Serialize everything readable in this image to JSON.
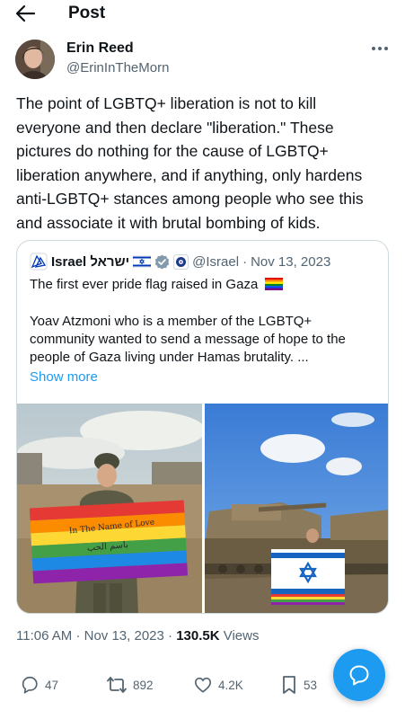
{
  "header": {
    "title": "Post"
  },
  "author": {
    "name": "Erin Reed",
    "handle": "@ErinInTheMorn"
  },
  "tweet": {
    "lines": [
      "The point of LGBTQ+ liberation is not to kill",
      "everyone and then declare \"liberation.\" These",
      "pictures do nothing for the cause of LGBTQ+",
      "liberation anywhere, and if anything, only hardens",
      "anti-LGBTQ+ stances among people who see this",
      "and associate it with brutal bombing of kids."
    ]
  },
  "quote": {
    "name": "Israel ישראל",
    "handle": "@Israel",
    "separator": "·",
    "date": "Nov 13, 2023",
    "line1": "The first ever pride flag raised in Gaza",
    "body_lines": [
      "Yoav Atzmoni who is a member of the LGBTQ+",
      "community wanted to send a message of hope to the",
      "people of Gaza living under Hamas brutality. ..."
    ],
    "show_more": "Show more",
    "photo1_flag_text": "In The Name of Love",
    "photo1_flag_text2": "باسم الحب"
  },
  "meta": {
    "time": "11:06 AM",
    "sep": "·",
    "date": "Nov 13, 2023",
    "views_count": "130.5K",
    "views_label": "Views"
  },
  "actions": {
    "replies": "47",
    "reposts": "892",
    "likes": "4.2K",
    "bookmarks": "53"
  },
  "colors": {
    "accent": "#1d9bf0",
    "text": "#0f1419",
    "muted": "#536471",
    "border": "#cfd9de"
  }
}
